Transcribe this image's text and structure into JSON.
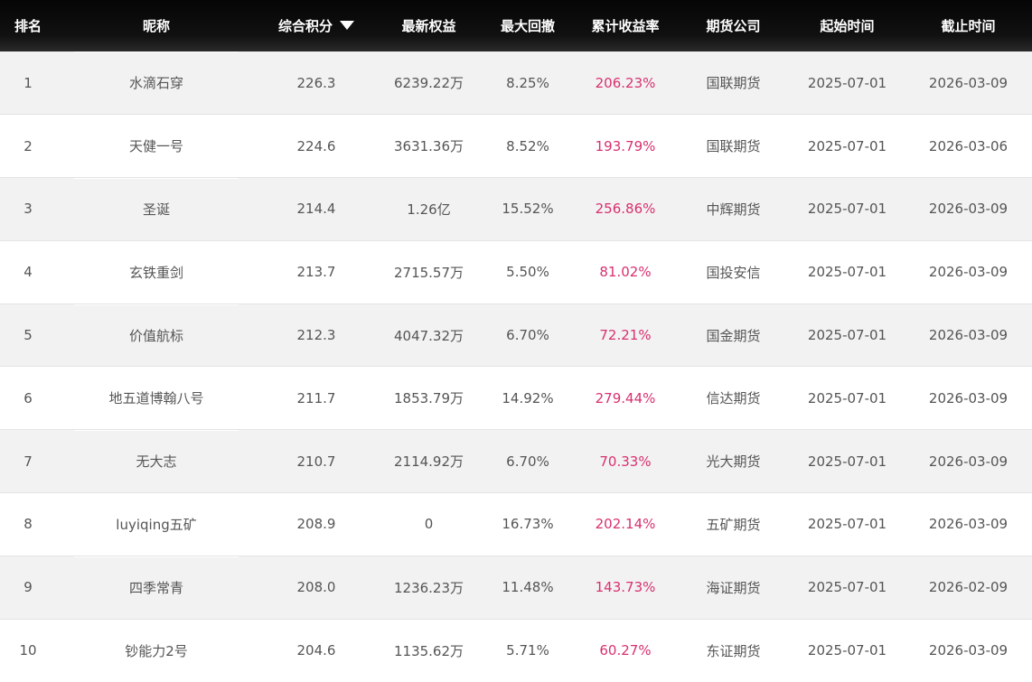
{
  "header": {
    "rank": "排名",
    "nickname": "昵称",
    "score": "综合积分",
    "equity": "最新权益",
    "drawdown": "最大回撤",
    "return": "累计收益率",
    "company": "期货公司",
    "start": "起始时间",
    "end": "截止时间"
  },
  "rows": [
    {
      "rank": "1",
      "nickname": "水滴石穿",
      "score": "226.3",
      "equity": "6239.22万",
      "drawdown": "8.25%",
      "return": "206.23%",
      "company": "国联期货",
      "start": "2025-07-01",
      "end": "2026-03-09"
    },
    {
      "rank": "2",
      "nickname": "天健一号",
      "score": "224.6",
      "equity": "3631.36万",
      "drawdown": "8.52%",
      "return": "193.79%",
      "company": "国联期货",
      "start": "2025-07-01",
      "end": "2026-03-06"
    },
    {
      "rank": "3",
      "nickname": "圣诞",
      "score": "214.4",
      "equity": "1.26亿",
      "drawdown": "15.52%",
      "return": "256.86%",
      "company": "中辉期货",
      "start": "2025-07-01",
      "end": "2026-03-09"
    },
    {
      "rank": "4",
      "nickname": "玄铁重剑",
      "score": "213.7",
      "equity": "2715.57万",
      "drawdown": "5.50%",
      "return": "81.02%",
      "company": "国投安信",
      "start": "2025-07-01",
      "end": "2026-03-09"
    },
    {
      "rank": "5",
      "nickname": "价值航标",
      "score": "212.3",
      "equity": "4047.32万",
      "drawdown": "6.70%",
      "return": "72.21%",
      "company": "国金期货",
      "start": "2025-07-01",
      "end": "2026-03-09"
    },
    {
      "rank": "6",
      "nickname": "地五道博翰八号",
      "score": "211.7",
      "equity": "1853.79万",
      "drawdown": "14.92%",
      "return": "279.44%",
      "company": "信达期货",
      "start": "2025-07-01",
      "end": "2026-03-09"
    },
    {
      "rank": "7",
      "nickname": "无大志",
      "score": "210.7",
      "equity": "2114.92万",
      "drawdown": "6.70%",
      "return": "70.33%",
      "company": "光大期货",
      "start": "2025-07-01",
      "end": "2026-03-09"
    },
    {
      "rank": "8",
      "nickname": "luyiqing五矿",
      "score": "208.9",
      "equity": "0",
      "drawdown": "16.73%",
      "return": "202.14%",
      "company": "五矿期货",
      "start": "2025-07-01",
      "end": "2026-03-09"
    },
    {
      "rank": "9",
      "nickname": "四季常青",
      "score": "208.0",
      "equity": "1236.23万",
      "drawdown": "11.48%",
      "return": "143.73%",
      "company": "海证期货",
      "start": "2025-07-01",
      "end": "2026-02-09"
    },
    {
      "rank": "10",
      "nickname": "钞能力2号",
      "score": "204.6",
      "equity": "1135.62万",
      "drawdown": "5.71%",
      "return": "60.27%",
      "company": "东证期货",
      "start": "2025-07-01",
      "end": "2026-03-09"
    }
  ],
  "colors": {
    "header_bg": "#0a0a0a",
    "header_text": "#ffffff",
    "row_odd": "#f2f2f2",
    "row_even": "#ffffff",
    "text": "#555555",
    "return_text": "#d9306f"
  },
  "icons": {
    "sort": "sort-descending-triangle-icon"
  }
}
